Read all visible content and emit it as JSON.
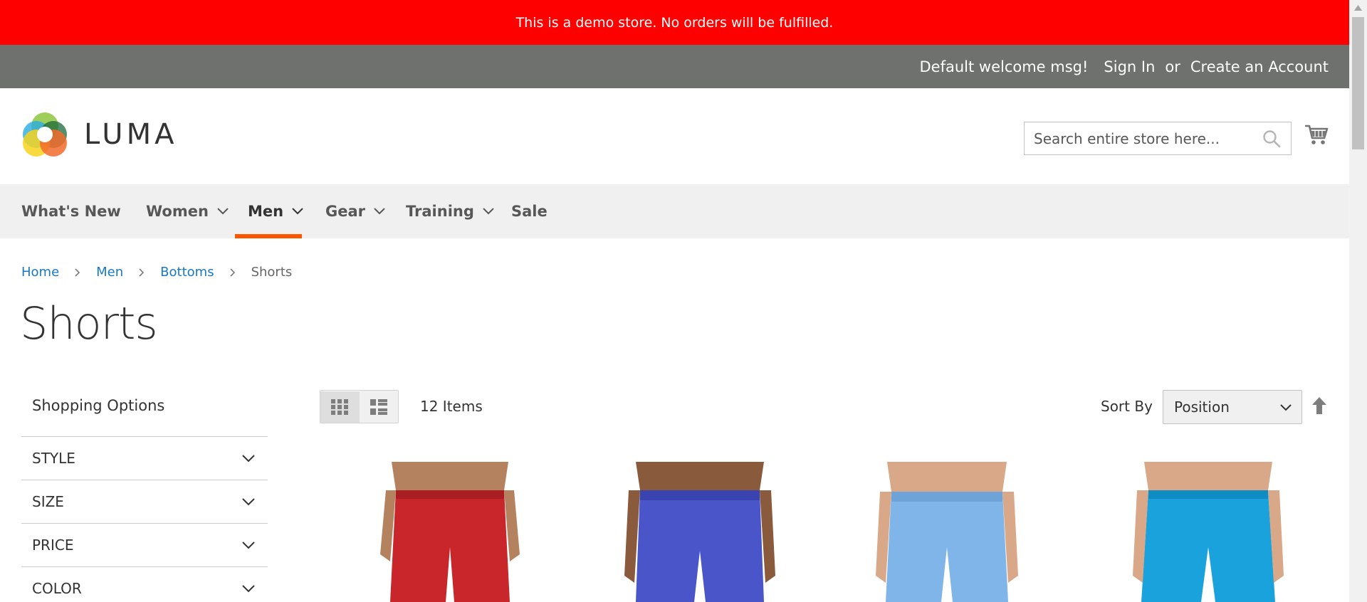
{
  "demo_notice": "This is a demo store. No orders will be fulfilled.",
  "header_panel": {
    "welcome": "Default welcome msg!",
    "sign_in": "Sign In",
    "or": "or",
    "create_account": "Create an Account"
  },
  "logo": {
    "text": "LUMA"
  },
  "search": {
    "placeholder": "Search entire store here..."
  },
  "nav": {
    "items": [
      {
        "label": "What's New",
        "has_dropdown": false
      },
      {
        "label": "Women",
        "has_dropdown": true
      },
      {
        "label": "Men",
        "has_dropdown": true,
        "active": true
      },
      {
        "label": "Gear",
        "has_dropdown": true
      },
      {
        "label": "Training",
        "has_dropdown": true
      },
      {
        "label": "Sale",
        "has_dropdown": false
      }
    ]
  },
  "breadcrumbs": [
    "Home",
    "Men",
    "Bottoms",
    "Shorts"
  ],
  "page_title": "Shorts",
  "sidebar": {
    "title": "Shopping Options",
    "filters": [
      "STYLE",
      "SIZE",
      "PRICE",
      "COLOR"
    ]
  },
  "toolbar": {
    "items_count": "12 Items",
    "sort_label": "Sort By",
    "sort_value": "Position"
  },
  "products": [
    {
      "color": "#c8262a"
    },
    {
      "color": "#4a55c9"
    },
    {
      "color": "#7fb5e8"
    },
    {
      "color": "#1aa2dc"
    }
  ],
  "colors": {
    "demo_bar": "#ff0000",
    "header_panel": "#6e716e",
    "link": "#1979c3",
    "nav_active": "#ff5501"
  }
}
